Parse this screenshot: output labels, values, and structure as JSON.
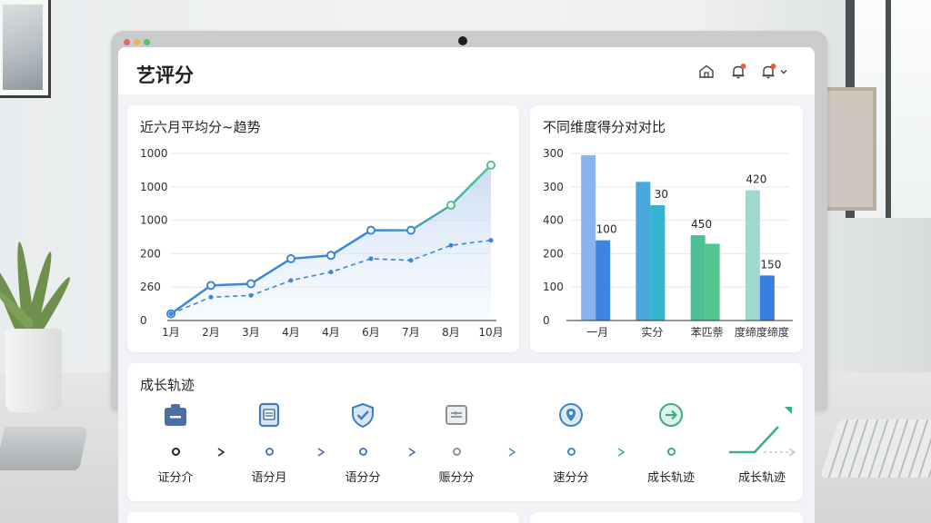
{
  "app": {
    "title": "艺评分"
  },
  "header": {
    "icons": [
      "home-icon",
      "bell-icon",
      "notification-icon",
      "chevron-down-icon"
    ],
    "badge_color": "#e8603c"
  },
  "line_card": {
    "title": "近六月平均分~趋势"
  },
  "bar_card": {
    "title": "不同维度得分对对比"
  },
  "timeline_card": {
    "title": "成长轨迹",
    "stages": [
      {
        "label": "证分介",
        "icon": "clipboard-icon",
        "color": "#4a6fa5"
      },
      {
        "label": "语分月",
        "icon": "document-icon",
        "color": "#4a7ab5"
      },
      {
        "label": "语分分",
        "icon": "shield-check-icon",
        "color": "#3f7cc7"
      },
      {
        "label": "赈分分",
        "icon": "card-icon",
        "color": "#8a9098"
      },
      {
        "label": "速分分",
        "icon": "location-pin-icon",
        "color": "#3e86c4"
      },
      {
        "label": "成长轨迹",
        "icon": "arrow-circle-icon",
        "color": "#3fa88a"
      },
      {
        "label": "成长轨迹",
        "icon": "trend-up-icon",
        "color": "#36b07f"
      }
    ]
  },
  "chart_data": [
    {
      "type": "line",
      "title": "近六月平均分~趋势",
      "y_tick_labels": [
        "1000",
        "1000",
        "1000",
        "200",
        "260",
        "0"
      ],
      "x": [
        "1月",
        "2月",
        "3月",
        "4月",
        "4月",
        "6月",
        "7月",
        "8月",
        "10月"
      ],
      "series": [
        {
          "values": [
            0.04,
            0.21,
            0.22,
            0.37,
            0.39,
            0.54,
            0.54,
            0.69,
            0.93
          ],
          "color": "#3a86d8",
          "style": "solid",
          "markers": true
        },
        {
          "values": [
            0.04,
            0.14,
            0.15,
            0.24,
            0.29,
            0.37,
            0.36,
            0.45,
            0.48
          ],
          "color": "#3a86d8",
          "style": "dashed",
          "markers": false
        }
      ],
      "series_end_color": "#4fc08f",
      "grid": true
    },
    {
      "type": "bar",
      "title": "不同维度得分对对比",
      "y_tick_labels": [
        "300",
        "300",
        "400",
        "200",
        "100",
        "0"
      ],
      "categories": [
        "一月",
        "实分",
        "苯匹萘",
        "度缔度缔度"
      ],
      "series": [
        {
          "values": [
            0.99,
            0.83,
            0.51,
            0.78
          ],
          "colors": [
            "#8ab4ee",
            "#4aa7dc",
            "#4cbf95",
            "#9ed8cf"
          ]
        },
        {
          "values": [
            0.48,
            0.69,
            0.46,
            0.27
          ],
          "colors": [
            "#3f85e0",
            "#36b3cf",
            "#52c58c",
            "#3a7ee0"
          ]
        }
      ],
      "data_labels": [
        {
          "category": 0,
          "series": 1,
          "text": "100"
        },
        {
          "category": 1,
          "series": 1,
          "text": "30"
        },
        {
          "category": 2,
          "series": 0,
          "text": "450"
        },
        {
          "category": 3,
          "series": 0,
          "text": "420"
        },
        {
          "category": 3,
          "series": 1,
          "text": "150"
        }
      ],
      "grid": true
    }
  ]
}
